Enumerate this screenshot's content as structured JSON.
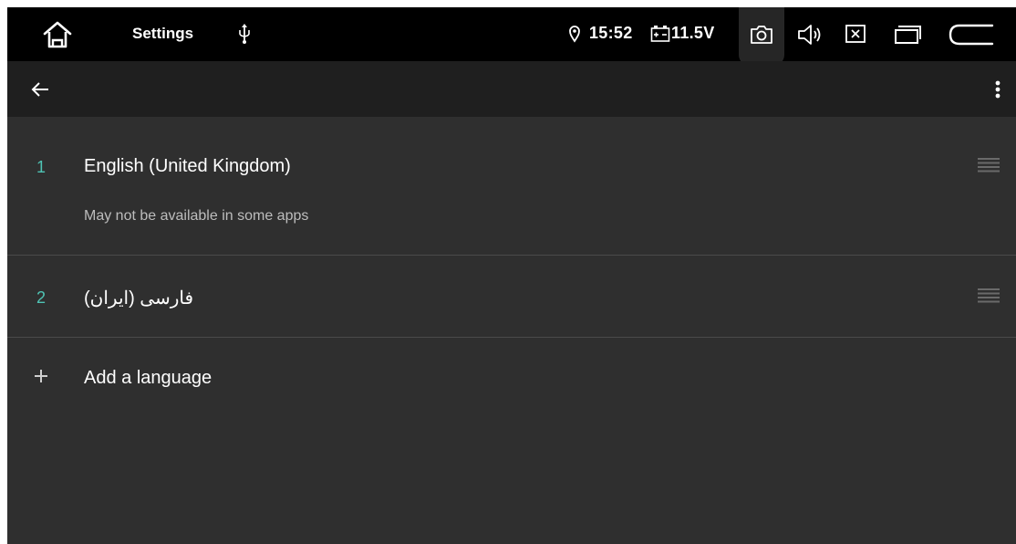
{
  "statusbar": {
    "app_title": "Settings",
    "time": "15:52",
    "voltage": "11.5V",
    "icons": [
      "home-icon",
      "usb-icon",
      "location-icon",
      "battery-icon",
      "camera-icon",
      "volume-icon",
      "close-box-icon",
      "recent-apps-icon",
      "back-nav-icon"
    ]
  },
  "actionbar": {
    "icons": [
      "back-arrow-icon",
      "more-vert-icon"
    ]
  },
  "languages": [
    {
      "number": "1",
      "name": "English (United Kingdom)",
      "note": "May not be available in some apps"
    },
    {
      "number": "2",
      "name": "فارسی (ایران)"
    }
  ],
  "add_language": {
    "icon": "plus-icon",
    "label": "Add a language"
  },
  "colors": {
    "accent": "#4fc3b4",
    "background": "#2f2f2f",
    "statusbar": "#000000",
    "actionbar": "#1f1f1f",
    "secondary_text": "#bdbdbd",
    "divider": "#4a4a4a"
  }
}
